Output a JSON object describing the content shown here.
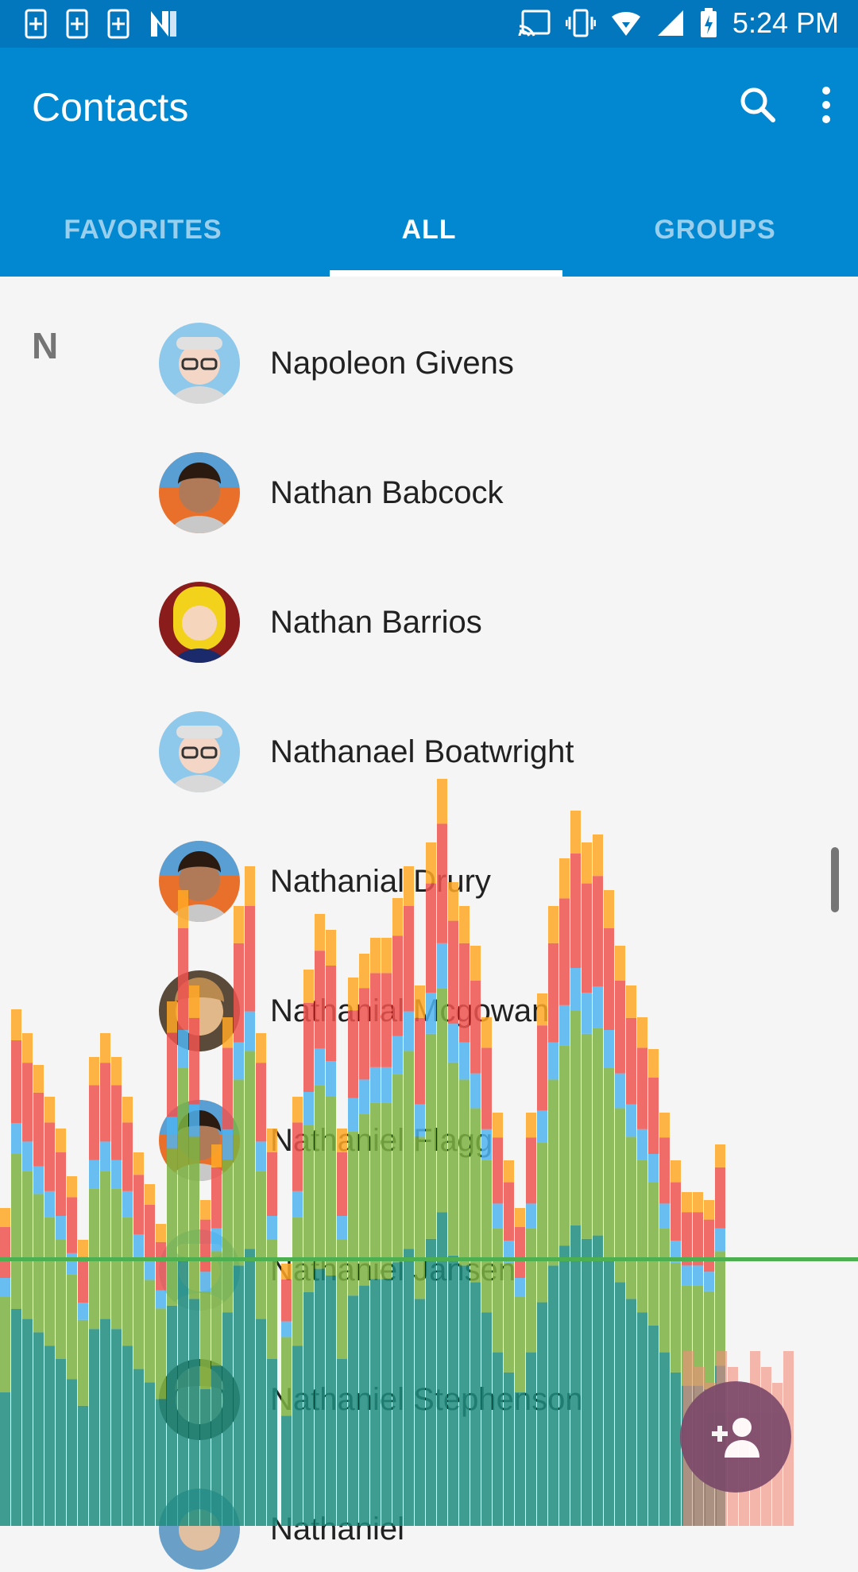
{
  "status_bar": {
    "time": "5:24 PM",
    "left_icons": [
      "sim-add-icon",
      "sim-add-icon",
      "sim-add-icon",
      "n-logo-icon"
    ],
    "right_icons": [
      "cast-icon",
      "vibrate-icon",
      "wifi-icon",
      "signal-icon",
      "battery-charging-icon"
    ]
  },
  "app_bar": {
    "title": "Contacts",
    "actions": [
      "search-icon",
      "more-vert-icon"
    ],
    "color": "#0288d1"
  },
  "tabs": [
    {
      "label": "FAVORITES",
      "active": false
    },
    {
      "label": "ALL",
      "active": true
    },
    {
      "label": "GROUPS",
      "active": false
    }
  ],
  "list": {
    "section": "N",
    "contacts": [
      "Napoleon Givens",
      "Nathan Babcock",
      "Nathan Barrios",
      "Nathanael Boatwright",
      "Nathanial Drury",
      "Nathanial Mcgowan",
      "Nathaniel Flagg",
      "Nathaniel Jansen",
      "Nathaniel Stephenson",
      "Nathaniel"
    ]
  },
  "fab": {
    "icon": "add-contact-icon"
  }
}
